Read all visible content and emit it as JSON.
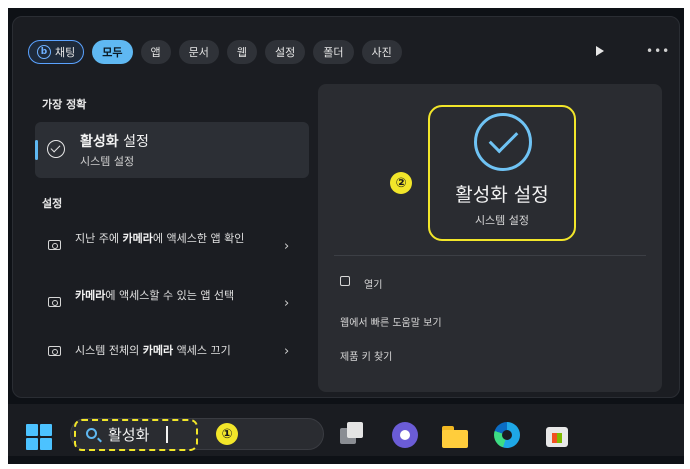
{
  "filters": {
    "bing_label": "채팅",
    "bing_icon": "b",
    "items": [
      "모두",
      "앱",
      "문서",
      "웹",
      "설정",
      "폴더",
      "사진"
    ],
    "active_index": 0
  },
  "left": {
    "best_match_heading": "가장 정확",
    "best_match": {
      "title_bold": "활성화",
      "title_rest": " 설정",
      "subtitle": "시스템 설정"
    },
    "settings_heading": "설정",
    "results": [
      {
        "pre": "지난 주에 ",
        "bold": "카메라",
        "post": "에 액세스한 앱 확인"
      },
      {
        "pre": "",
        "bold": "카메라",
        "post": "에 액세스할 수 있는 앱 선택"
      },
      {
        "pre": "시스템 전체의 ",
        "bold": "카메라",
        "post": " 액세스 끄기"
      }
    ]
  },
  "preview": {
    "title": "활성화 설정",
    "subtitle": "시스템 설정",
    "actions": [
      "열기",
      "웹에서 빠른 도움말 보기",
      "제품 키 찾기"
    ]
  },
  "annotations": {
    "one": "①",
    "two": "②"
  },
  "taskbar": {
    "search_query": "활성화",
    "apps": [
      "task-view-icon",
      "chat-icon",
      "file-explorer-icon",
      "edge-icon",
      "store-icon"
    ]
  },
  "colors": {
    "accent": "#5fb8f2",
    "highlight": "#f2e62a"
  }
}
